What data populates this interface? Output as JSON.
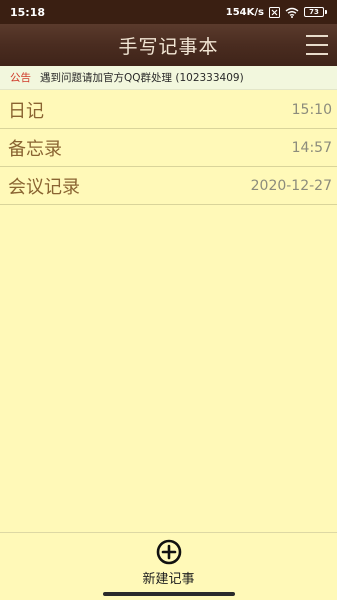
{
  "status_bar": {
    "time": "15:18",
    "network_speed": "154K/s",
    "battery": "73",
    "icons": [
      "sim-x-icon",
      "wifi-icon",
      "battery-icon"
    ]
  },
  "header": {
    "title": "手写记事本",
    "menu_icon": "menu-icon"
  },
  "notice": {
    "label": "公告",
    "text": "遇到问题请加官方QQ群处理 (102333409)"
  },
  "notes": [
    {
      "title": "日记",
      "time": "15:10"
    },
    {
      "title": "备忘录",
      "time": "14:57"
    },
    {
      "title": "会议记录",
      "time": "2020-12-27"
    }
  ],
  "footer": {
    "new_note_label": "新建记事",
    "new_note_icon": "plus-circle-icon"
  },
  "colors": {
    "background": "#fff9b8",
    "header": "#4a2c20",
    "note_title": "#8a6432",
    "notice_label": "#d03a2a"
  }
}
